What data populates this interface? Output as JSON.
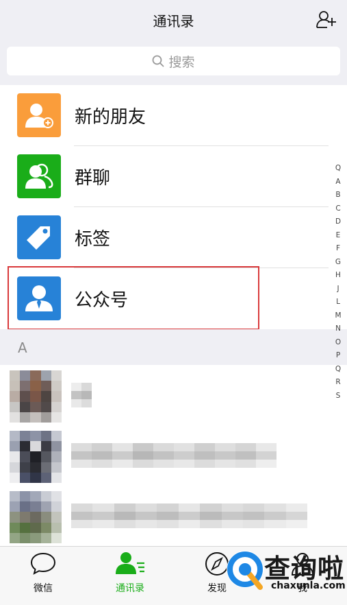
{
  "header": {
    "title": "通讯录",
    "add_friend_icon": "add-contact-icon"
  },
  "search": {
    "placeholder": "搜索"
  },
  "menu": [
    {
      "label": "新的朋友",
      "icon": "new-friend-icon",
      "color": "#fa9d3b"
    },
    {
      "label": "群聊",
      "icon": "group-chat-icon",
      "color": "#1aad19"
    },
    {
      "label": "标签",
      "icon": "tag-icon",
      "color": "#2782d7"
    },
    {
      "label": "公众号",
      "icon": "official-account-icon",
      "color": "#2782d7"
    }
  ],
  "section": {
    "letter": "A"
  },
  "index_letters": [
    "Q",
    "A",
    "B",
    "C",
    "D",
    "E",
    "F",
    "G",
    "H",
    "J",
    "L",
    "M",
    "N",
    "O",
    "P",
    "Q",
    "R",
    "S"
  ],
  "tabs": [
    {
      "label": "微信",
      "icon": "chat-icon",
      "active": false
    },
    {
      "label": "通讯录",
      "icon": "contacts-icon",
      "active": true
    },
    {
      "label": "发现",
      "icon": "discover-icon",
      "active": false
    },
    {
      "label": "我",
      "icon": "me-icon",
      "active": false
    }
  ],
  "watermark": {
    "text": "查询啦",
    "url": "chaxunla.com"
  },
  "colors": {
    "accent": "#1aad19",
    "highlight": "#d9393b"
  }
}
